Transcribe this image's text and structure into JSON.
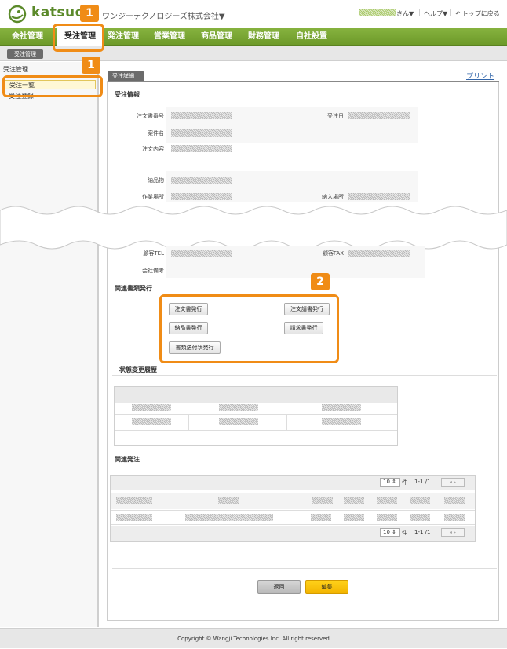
{
  "header": {
    "brand": "katsuo",
    "company": "ワンジーテクノロジーズ株式会社▼",
    "user_suffix": "さん▼",
    "help": "ヘルプ▼",
    "back_top": "トップに戻る"
  },
  "nav": {
    "items": [
      "会社管理",
      "受注管理",
      "発注管理",
      "営業管理",
      "商品管理",
      "財務管理",
      "自社設置"
    ],
    "active": "受注管理"
  },
  "subnav": {
    "button": "受注管理"
  },
  "sidebar": {
    "title": "受注管理",
    "items": [
      "受注一覧",
      "受注登録"
    ]
  },
  "content": {
    "tab": "受注詳細",
    "print": "プリント",
    "section_info": "受注情報",
    "fields": {
      "order_no": "注文書番号",
      "order_date": "受注日",
      "project": "案件名",
      "order_content": "注文内容",
      "delivery": "納品物",
      "work_place": "作業場所",
      "delivery_place": "納入場所",
      "customer_tel": "顧客TEL",
      "customer_fax": "顧客FAX",
      "company_note": "会社備考"
    },
    "section_docs": "関連書類発行",
    "doc_buttons": {
      "order_sheet": "注文書発行",
      "order_confirm": "注文請書発行",
      "delivery_note": "納品書発行",
      "invoice": "請求書発行",
      "cover_letter": "書類送付状発行"
    },
    "section_history": "状態変更履歴",
    "section_related": "関連発注",
    "pager": {
      "per_page": "10",
      "per_unit": "件",
      "range": "1-1 /1",
      "nav": "◂ ▸"
    },
    "back_button": "返回",
    "edit_button": "編集"
  },
  "callouts": {
    "badge1": "1",
    "badge2": "2"
  },
  "footer": "Copyright © Wangji Technologies Inc. All right reserved",
  "colors": {
    "nav_green": "#7aa735",
    "callout_orange": "#f08c16",
    "edit_yellow": "#f9c20a"
  }
}
